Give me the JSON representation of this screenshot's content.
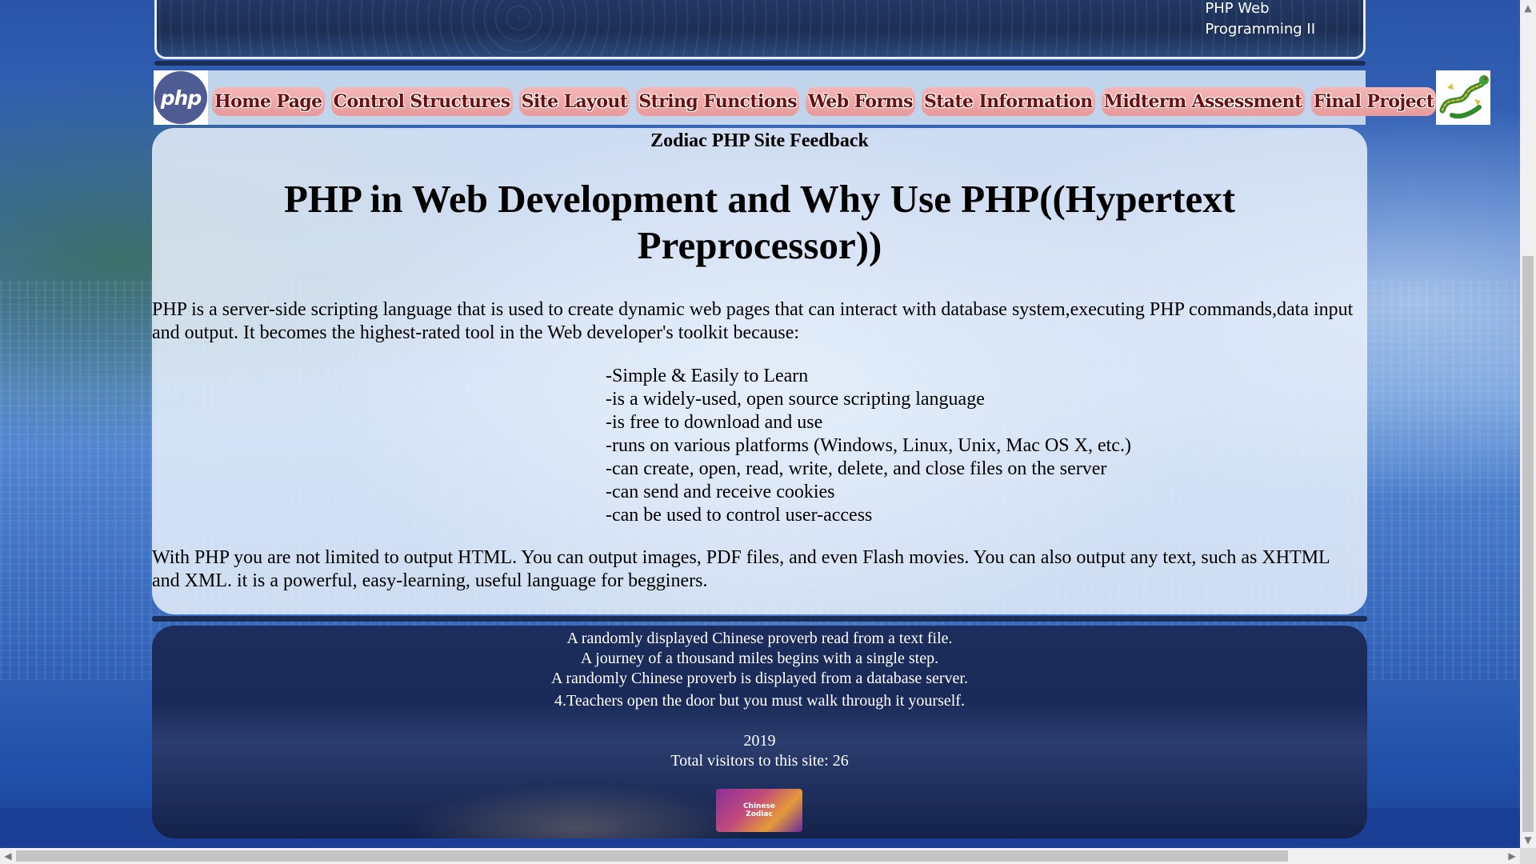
{
  "banner": {
    "caption_line1": "PHP Web",
    "caption_line2": "Programming II"
  },
  "nav": {
    "logo_text": "php",
    "items": [
      {
        "label": "Home Page"
      },
      {
        "label": "Control Structures"
      },
      {
        "label": "Site Layout"
      },
      {
        "label": "String Functions"
      },
      {
        "label": "Web Forms"
      },
      {
        "label": "State Information"
      },
      {
        "label": "Midterm Assessment"
      },
      {
        "label": "Final Project"
      }
    ]
  },
  "main": {
    "feedback_link": "Zodiac PHP Site Feedback",
    "title": "PHP in Web Development and Why Use PHP((Hypertext Preprocessor))",
    "intro": "PHP is a server-side scripting language that is used to create dynamic web pages that can interact with database system,executing PHP commands,data input and output. It becomes the highest-rated tool in the Web developer's toolkit because:",
    "reasons": [
      "-Simple & Easily to Learn",
      "-is a widely-used, open source scripting language",
      "-is free to download and use",
      "-runs on various platforms (Windows, Linux, Unix, Mac OS X, etc.)",
      "-can create, open, read, write, delete, and close files on the server",
      "-can send and receive cookies",
      "-can be used to control user-access"
    ],
    "outro": "With PHP you are not limited to output HTML. You can output images, PDF files, and even Flash movies. You can also output any text, such as XHTML and XML. it is a powerful, easy-learning, useful language for begginers."
  },
  "footer": {
    "proverb_file_caption": "A randomly displayed Chinese proverb read from a text file.",
    "proverb_file_text": "A journey of a thousand miles begins with a single step.",
    "proverb_db_caption": "A randomly Chinese proverb is displayed from a database server.",
    "proverb_db_text": "4.Teachers open the door but you must walk through it yourself.",
    "year": "2019",
    "visitors": "Total visitors to this site: 26",
    "badge_line1": "Chinese",
    "badge_line2": "Zodiac"
  },
  "colors": {
    "nav_button": "#e99a9a",
    "nav_text": "#6b1010",
    "footer_bg": "#1a2a58",
    "php_logo": "#4f5b93"
  },
  "icons": {
    "php_logo": "php-logo-icon",
    "dragon": "dragon-icon",
    "scroll_up": "▲",
    "scroll_down": "▼",
    "scroll_left": "◀",
    "scroll_right": "▶"
  }
}
